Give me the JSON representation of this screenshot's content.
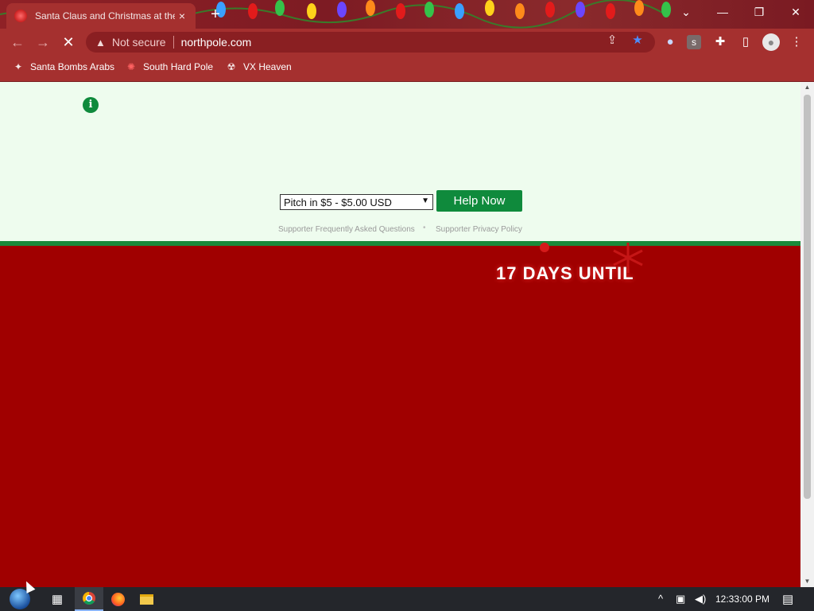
{
  "browser": {
    "tab": {
      "title": "Santa Claus and Christmas at the",
      "close_icon": "×"
    },
    "new_tab_icon": "+",
    "window_controls": {
      "tabsearch": "⌄",
      "minimize": "—",
      "restore": "❐",
      "close": "✕"
    },
    "nav": {
      "back": "←",
      "forward": "→",
      "reload": "✕"
    },
    "omnibox": {
      "security_icon": "▲",
      "security_text": "Not secure",
      "url": "northpole.com"
    },
    "toolbar_icons": {
      "share": "⇪",
      "bookmark_star": "★",
      "profile": "●",
      "extensions": "✚",
      "sidepanel": "▯",
      "menu": "⋮",
      "ext_s": "s"
    },
    "bookmarks": [
      {
        "label": "Santa Bombs Arabs",
        "icon": "✦"
      },
      {
        "label": "South Hard Pole",
        "icon": "✺"
      },
      {
        "label": "VX Heaven",
        "icon": "☢"
      }
    ]
  },
  "page": {
    "info_icon": "i",
    "pitch_select": {
      "selected": "Pitch in $5 - $5.00 USD",
      "arrow": "▼"
    },
    "help_button": "Help Now",
    "links": {
      "faq": "Supporter Frequently Asked Questions",
      "separator": "•",
      "privacy": "Supporter Privacy Policy"
    },
    "countdown": "17 DAYS UNTIL"
  },
  "taskbar": {
    "tray_chevron": "^",
    "network_icon": "▣",
    "volume_icon": "◀)",
    "clock": "12:33:00 PM",
    "notification_icon": "▤"
  },
  "colors": {
    "chrome_frame": "#a5302f",
    "page_red": "#a00000",
    "donate_bg": "#eefcee",
    "accent_green": "#0f8a3c"
  }
}
